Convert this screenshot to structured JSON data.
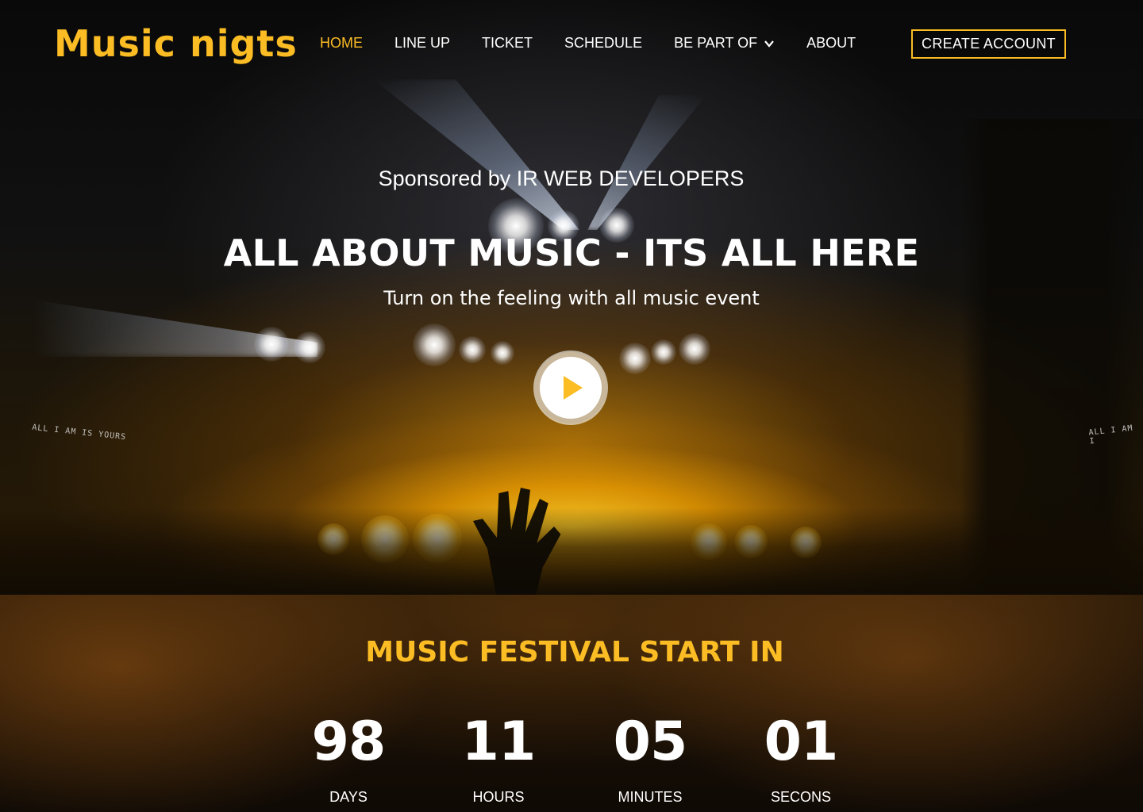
{
  "brand": {
    "logo": "Music nigts",
    "accent_color": "#fbbc24"
  },
  "nav": {
    "items": [
      {
        "label": "HOME",
        "active": true
      },
      {
        "label": "LINE UP",
        "active": false
      },
      {
        "label": "TICKET",
        "active": false
      },
      {
        "label": "SCHEDULE",
        "active": false
      },
      {
        "label": "BE PART OF",
        "active": false,
        "icon": "chevron-down-icon"
      },
      {
        "label": "ABOUT",
        "active": false
      }
    ],
    "cta_label": "CREATE ACCOUNT"
  },
  "hero": {
    "sponsor": "Sponsored  by IR WEB DEVELOPERS",
    "headline": "ALL ABOUT MUSIC - ITS ALL HERE",
    "tagline": "Turn on the feeling with all music event",
    "play_icon": "play-icon",
    "screen_text_left": "ALL I AM IS YOURS",
    "screen_text_right": "ALL I AM I"
  },
  "countdown": {
    "title": "MUSIC FESTIVAL START IN",
    "units": [
      {
        "value": "98",
        "label": "DAYS"
      },
      {
        "value": "11",
        "label": "HOURS"
      },
      {
        "value": "05",
        "label": "MINUTES"
      },
      {
        "value": "01",
        "label": "SECONS"
      }
    ]
  }
}
